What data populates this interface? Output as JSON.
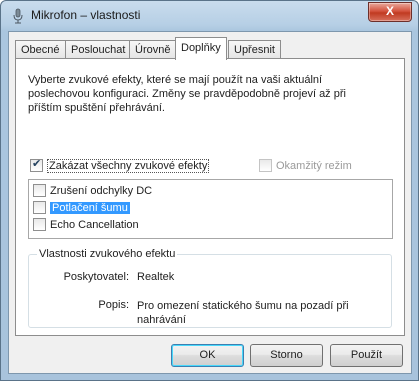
{
  "window": {
    "title": "Mikrofon – vlastnosti",
    "close_glyph": "X"
  },
  "tabs": [
    {
      "label": "Obecné",
      "active": false
    },
    {
      "label": "Poslouchat",
      "active": false
    },
    {
      "label": "Úrovně",
      "active": false
    },
    {
      "label": "Doplňky",
      "active": true
    },
    {
      "label": "Upřesnit",
      "active": false
    }
  ],
  "panel": {
    "description": "Vyberte zvukové efekty, které se mají použít na vaši aktuální poslechovou konfiguraci. Změny se pravděpodobně projeví až při příštím spuštění přehrávání.",
    "disable_all": {
      "label": "Zakázat všechny zvukové efekty",
      "checked": true
    },
    "immediate_mode": {
      "label": "Okamžitý režim",
      "checked": false,
      "enabled": false
    },
    "effects": [
      {
        "label": "Zrušení odchylky DC",
        "checked": false,
        "selected": false
      },
      {
        "label": "Potlačení šumu",
        "checked": false,
        "selected": true
      },
      {
        "label": "Echo Cancellation",
        "checked": false,
        "selected": false
      }
    ],
    "properties": {
      "title": "Vlastnosti zvukového efektu",
      "provider_label": "Poskytovatel:",
      "provider_value": "Realtek",
      "description_label": "Popis:",
      "description_value": "Pro omezení statického šumu na pozadí při nahrávání"
    }
  },
  "buttons": {
    "ok": "OK",
    "cancel": "Storno",
    "apply": "Použít"
  },
  "colors": {
    "selection": "#3399ff",
    "default_button_border": "#3c7fb1"
  }
}
